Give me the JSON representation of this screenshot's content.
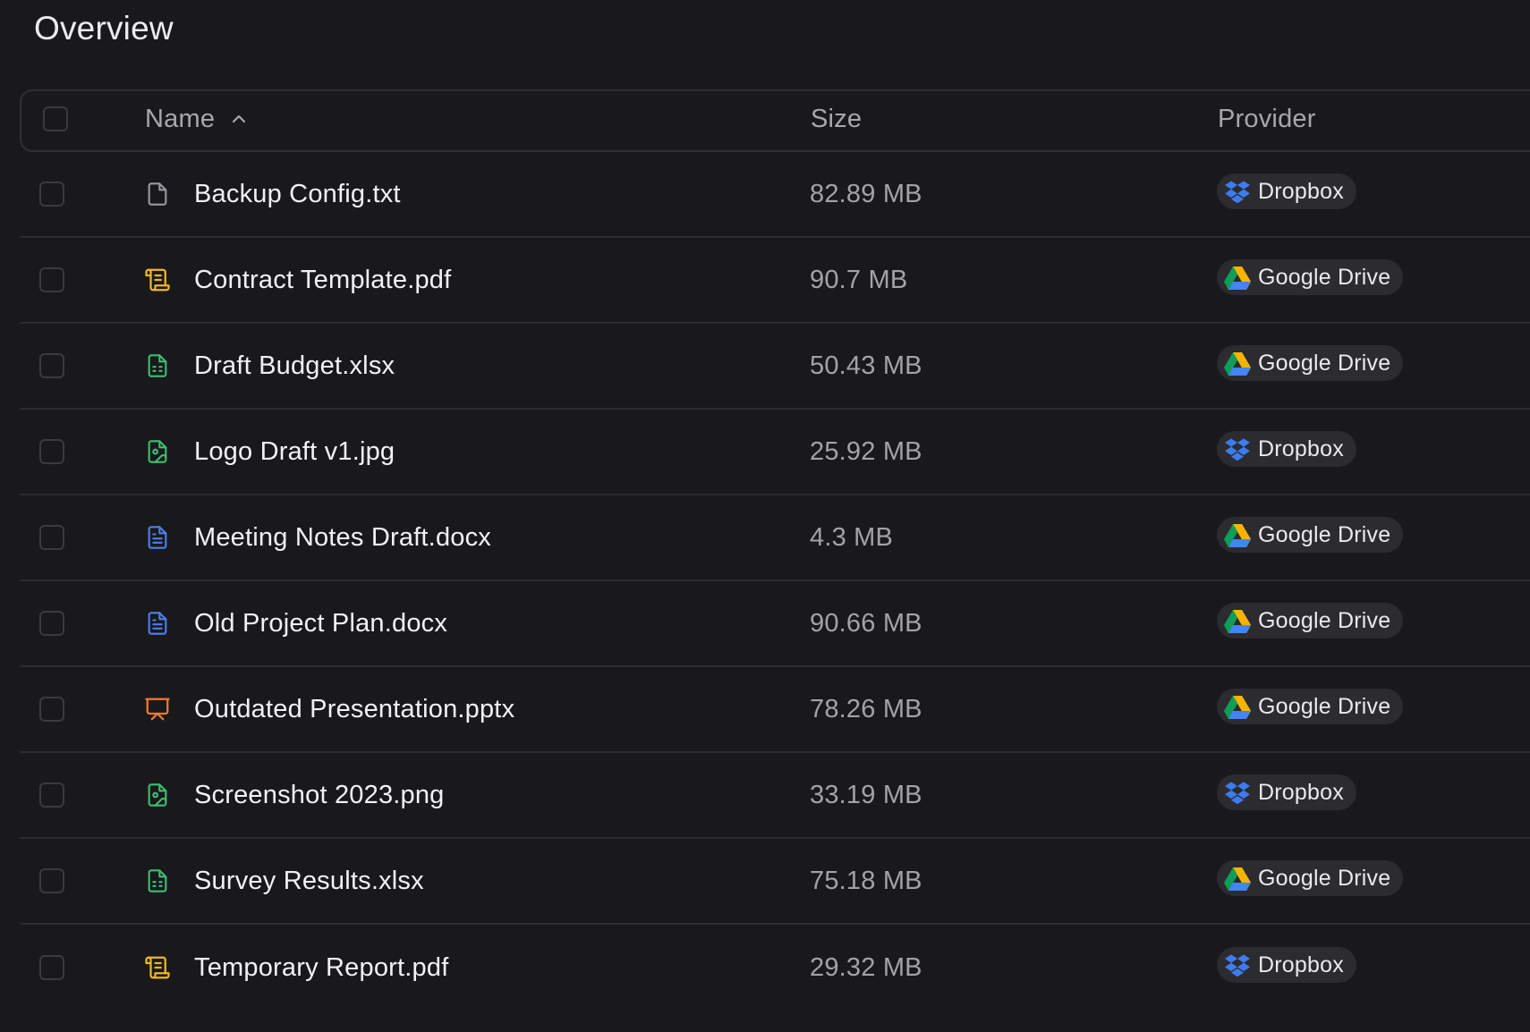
{
  "page": {
    "title": "Overview"
  },
  "table": {
    "columns": {
      "name": "Name",
      "size": "Size",
      "provider": "Provider"
    },
    "sort": {
      "column": "Name",
      "direction": "ascending",
      "icon": "chevron-up-icon"
    },
    "rows": [
      {
        "name": "Backup Config.txt",
        "size": "82.89 MB",
        "provider": "Dropbox",
        "file_icon": "text-file-icon",
        "icon_color": "#9a9aa2",
        "provider_icon": "dropbox-icon"
      },
      {
        "name": "Contract Template.pdf",
        "size": "90.7 MB",
        "provider": "Google Drive",
        "file_icon": "scroll-file-icon",
        "icon_color": "#f1b526",
        "provider_icon": "google-drive-icon"
      },
      {
        "name": "Draft Budget.xlsx",
        "size": "50.43 MB",
        "provider": "Google Drive",
        "file_icon": "spreadsheet-file-icon",
        "icon_color": "#3fbf74",
        "provider_icon": "google-drive-icon"
      },
      {
        "name": "Logo Draft v1.jpg",
        "size": "25.92 MB",
        "provider": "Dropbox",
        "file_icon": "image-file-icon",
        "icon_color": "#3fbf74",
        "provider_icon": "dropbox-icon"
      },
      {
        "name": "Meeting Notes Draft.docx",
        "size": "4.3 MB",
        "provider": "Google Drive",
        "file_icon": "document-file-icon",
        "icon_color": "#4f7ff0",
        "provider_icon": "google-drive-icon"
      },
      {
        "name": "Old Project Plan.docx",
        "size": "90.66 MB",
        "provider": "Google Drive",
        "file_icon": "document-file-icon",
        "icon_color": "#4f7ff0",
        "provider_icon": "google-drive-icon"
      },
      {
        "name": "Outdated Presentation.pptx",
        "size": "78.26 MB",
        "provider": "Google Drive",
        "file_icon": "presentation-file-icon",
        "icon_color": "#ef7a2f",
        "provider_icon": "google-drive-icon"
      },
      {
        "name": "Screenshot 2023.png",
        "size": "33.19 MB",
        "provider": "Dropbox",
        "file_icon": "image-file-icon",
        "icon_color": "#3fbf74",
        "provider_icon": "dropbox-icon"
      },
      {
        "name": "Survey Results.xlsx",
        "size": "75.18 MB",
        "provider": "Google Drive",
        "file_icon": "spreadsheet-file-icon",
        "icon_color": "#3fbf74",
        "provider_icon": "google-drive-icon"
      },
      {
        "name": "Temporary Report.pdf",
        "size": "29.32 MB",
        "provider": "Dropbox",
        "file_icon": "scroll-file-icon",
        "icon_color": "#f1b526",
        "provider_icon": "dropbox-icon"
      }
    ]
  },
  "colors": {
    "background": "#19191c",
    "border": "#2c2c31",
    "chip_background": "#2b2b30",
    "dropbox_blue": "#3d7cf0"
  }
}
